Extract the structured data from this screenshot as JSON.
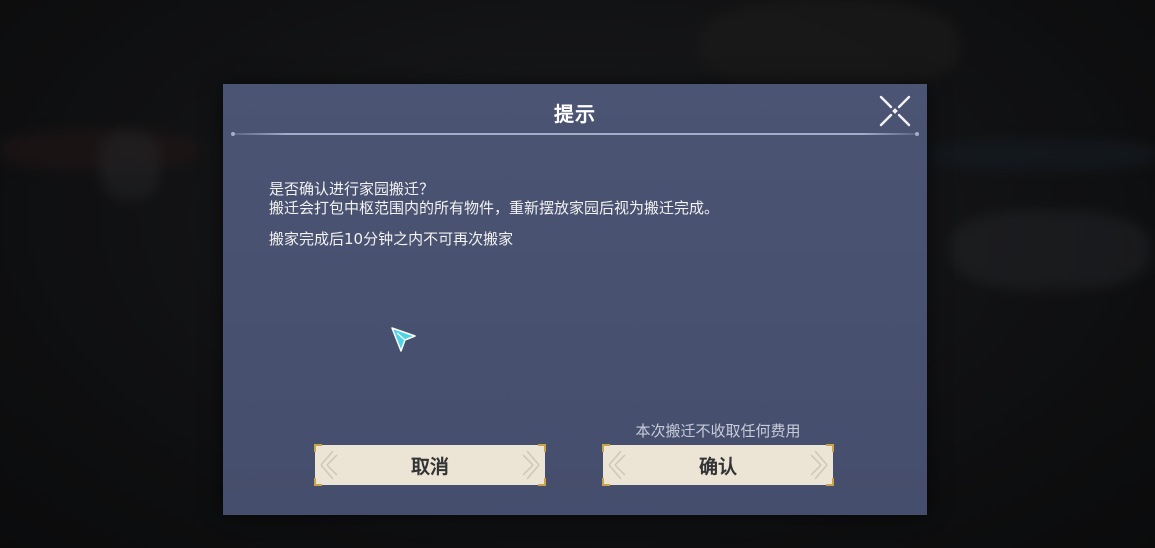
{
  "dialog": {
    "title": "提示",
    "lines": [
      "是否确认进行家园搬迁？",
      "搬迁会打包中枢范围内的所有物件，重新摆放家园后视为搬迁完成。",
      "搬家完成后10分钟之内不可再次搬家"
    ],
    "fee_note": "本次搬迁不收取任何费用",
    "cancel_label": "取消",
    "confirm_label": "确认"
  },
  "colors": {
    "panel": "#4b5473",
    "button": "#ece5d5",
    "button_text": "#333336",
    "accent_gold": "#c9a24a",
    "cursor": "#4fd3e6"
  },
  "icons": [
    "close-icon",
    "cursor-icon"
  ]
}
